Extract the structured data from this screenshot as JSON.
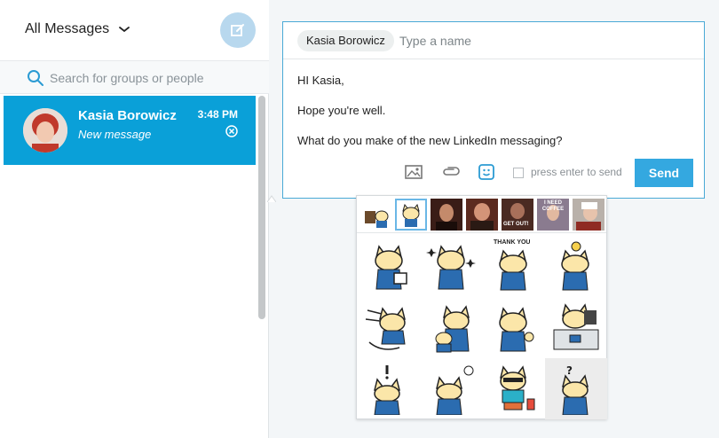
{
  "sidebar": {
    "filter_label": "All Messages",
    "search_placeholder": "Search for groups or people"
  },
  "conversation": {
    "name": "Kasia Borowicz",
    "subtitle": "New message",
    "time": "3:48 PM"
  },
  "compose": {
    "recipient": "Kasia Borowicz",
    "name_placeholder": "Type a name",
    "lines": [
      "HI Kasia,",
      "Hope you're well.",
      "What do you make of the new LinkedIn messaging?"
    ],
    "enter_to_send_label": "press enter to send",
    "send_label": "Send"
  },
  "sticker_packs": [
    {
      "icon": "coffee-cat-pack-icon",
      "selected": false
    },
    {
      "icon": "cat-pack-icon",
      "selected": true
    },
    {
      "icon": "movie-gif-pack-icon",
      "selected": false
    },
    {
      "icon": "movie-gif-pack-icon",
      "selected": false
    },
    {
      "icon": "get-out-gif-pack-icon",
      "text": "GET OUT!",
      "selected": false
    },
    {
      "icon": "need-coffee-gif-pack-icon",
      "text": "I NEED COFFEE",
      "selected": false
    },
    {
      "icon": "chef-gif-pack-icon",
      "selected": false
    }
  ],
  "stickers": [
    {
      "icon": "cat-with-coffee-sticker"
    },
    {
      "icon": "cat-sparkle-sticker"
    },
    {
      "icon": "cat-thank-you-sticker",
      "text": "THANK YOU"
    },
    {
      "icon": "cat-lightbulb-sticker"
    },
    {
      "icon": "cat-running-sticker"
    },
    {
      "icon": "cat-pair-sticker"
    },
    {
      "icon": "cat-thumbs-up-sticker"
    },
    {
      "icon": "cat-at-desk-sticker"
    },
    {
      "icon": "cat-exclamation-sticker"
    },
    {
      "icon": "cat-sweat-sticker"
    },
    {
      "icon": "cat-sunglasses-sticker"
    },
    {
      "icon": "cat-question-sticker",
      "hovered": true
    }
  ],
  "colors": {
    "accent": "#0aa0d8",
    "send": "#34a8e0",
    "compose_border": "#4aa9d6",
    "compose_button": "#b8d8ee"
  }
}
